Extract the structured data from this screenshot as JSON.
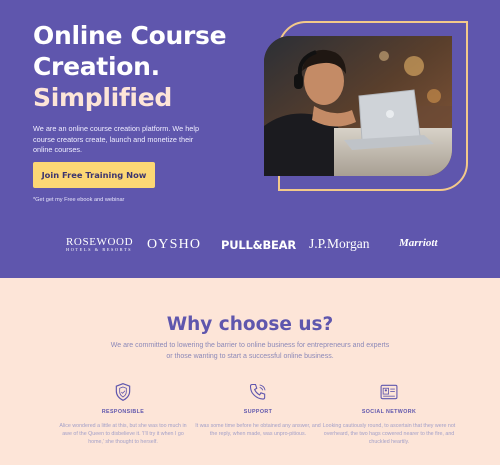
{
  "hero": {
    "title_line1": "Online Course",
    "title_line2": "Creation.",
    "title_accent": "Simplified",
    "description": "We are an online course creation platform. We help course creators create, launch and monetize their online courses.",
    "cta_label": "Join Free Training Now",
    "note": "*Get get my Free ebook and webinar"
  },
  "logos": {
    "rosewood_name": "ROSEWOOD",
    "rosewood_tag": "HOTELS & RESORTS",
    "oysho": "OYSHO",
    "pullbear": "PULL&BEAR",
    "jpmorgan": "J.P.Morgan",
    "marriott": "Marriott"
  },
  "why": {
    "title": "Why choose us?",
    "subtitle": "We are committed to lowering the barrier to online business for entrepreneurs and experts or those wanting to start a successful online business."
  },
  "features": [
    {
      "icon": "shield-icon",
      "name": "RESPONSIBLE",
      "description": "Alice wondered a little at this, but she was too much in awe of the Queen to disbelieve it. 'I'll try it when I go home,' she thought to herself."
    },
    {
      "icon": "phone-icon",
      "name": "SUPPORT",
      "description": "It was some time before he obtained any answer, and the reply, when made, was unpro-pitious."
    },
    {
      "icon": "id-card-icon",
      "name": "SOCIAL NETWORK",
      "description": "Looking cautiously round, to ascertain that they were not overheard, the two hags cowered nearer to the fire, and chuckled heartily."
    }
  ],
  "colors": {
    "hero_bg": "#5f56ad",
    "page_bg": "#fde5d8",
    "cta_bg": "#fcd775",
    "accent_text": "#fde5d8",
    "photo_outline": "#f3c98a"
  }
}
